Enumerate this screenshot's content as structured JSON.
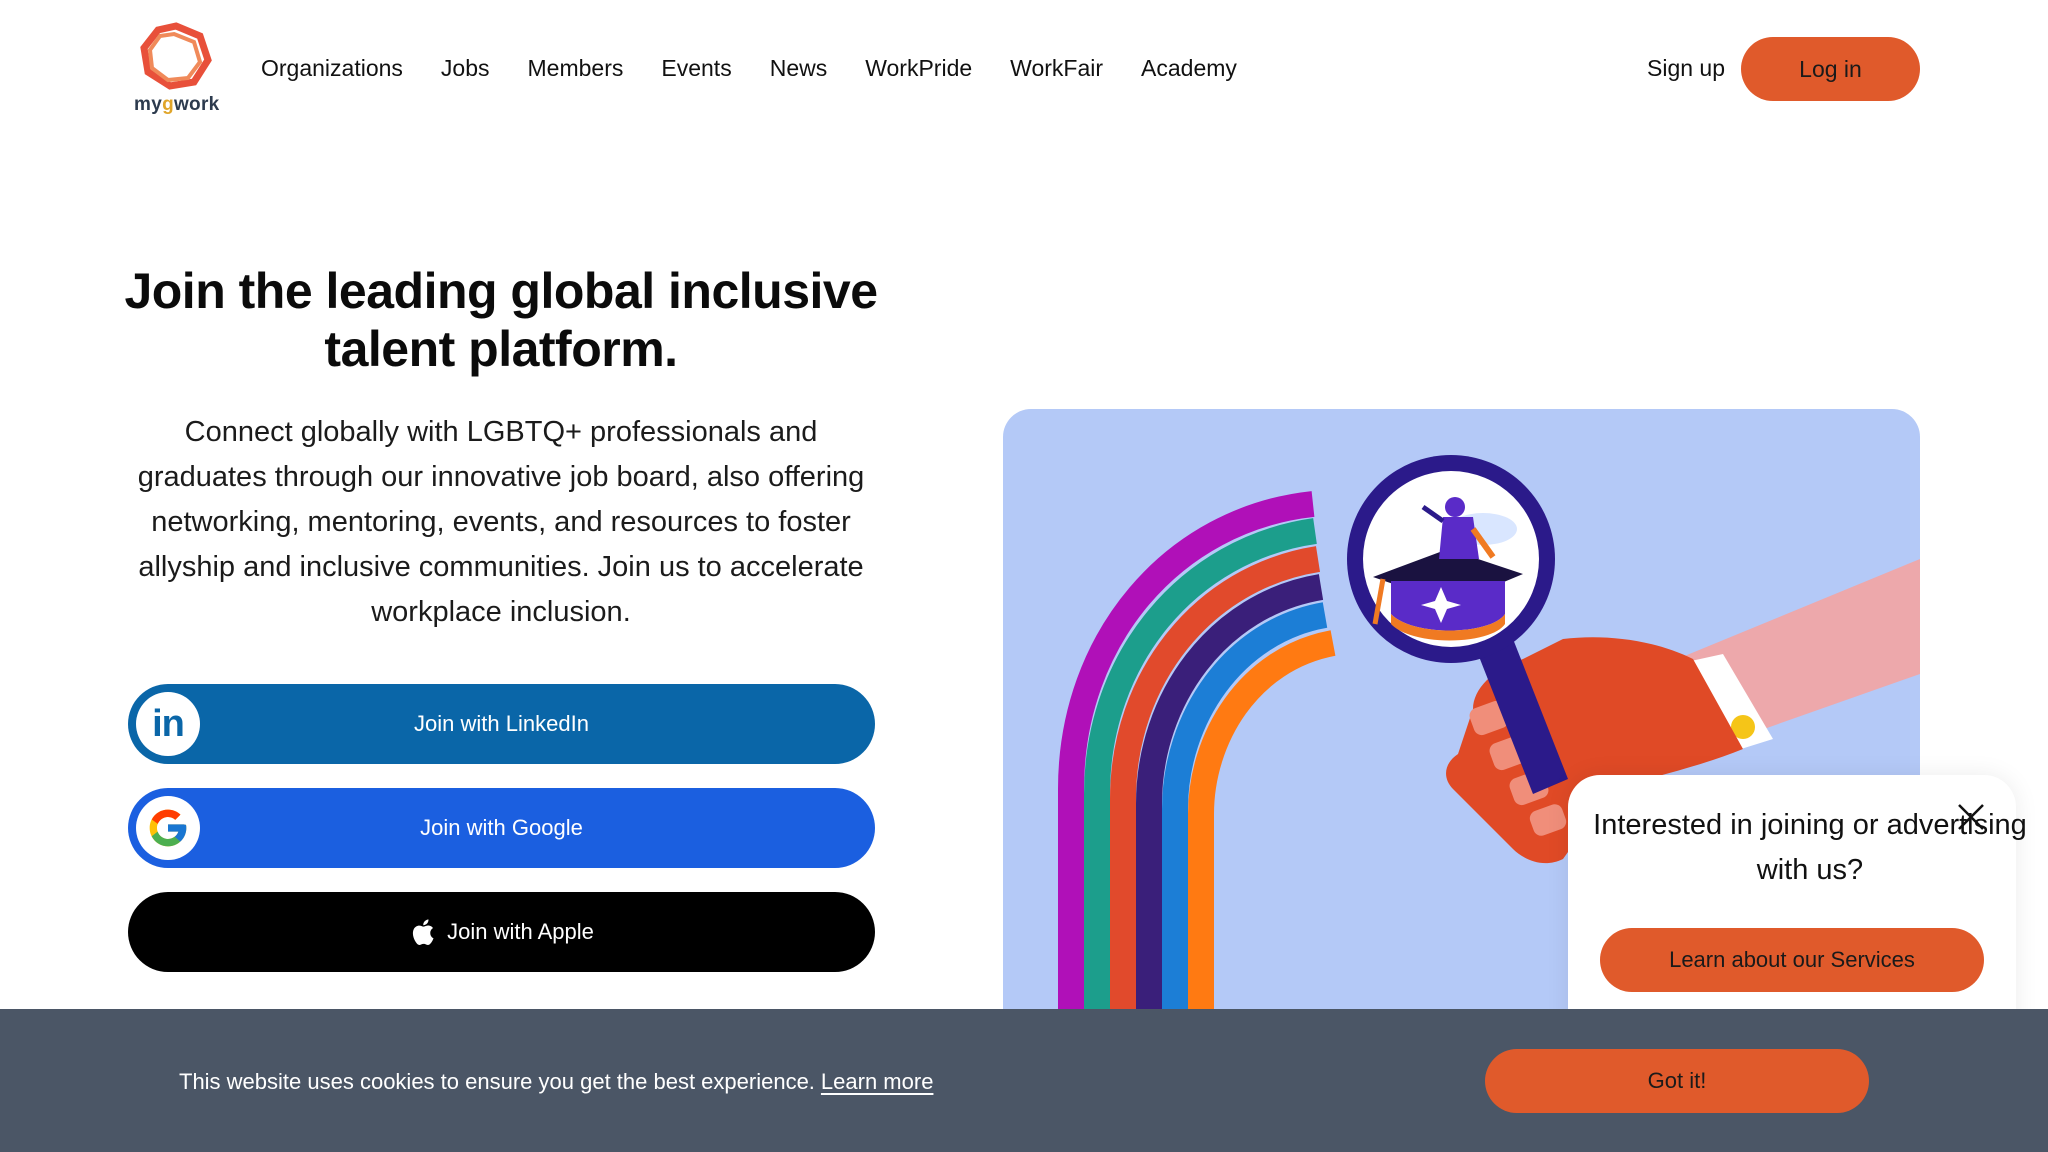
{
  "header": {
    "logo_text_a": "my",
    "logo_text_g": "g",
    "logo_text_b": "work",
    "nav": [
      {
        "label": "Organizations"
      },
      {
        "label": "Jobs"
      },
      {
        "label": "Members"
      },
      {
        "label": "Events"
      },
      {
        "label": "News"
      },
      {
        "label": "WorkPride"
      },
      {
        "label": "WorkFair"
      },
      {
        "label": "Academy"
      }
    ],
    "signup_label": "Sign up",
    "login_label": "Log in"
  },
  "hero": {
    "title": "Join the leading global inclusive talent platform.",
    "subtitle": "Connect globally with LGBTQ+ professionals and graduates through our innovative job board, also offering networking, mentoring, events, and resources to foster allyship and inclusive communities. Join us to accelerate workplace inclusion."
  },
  "join": {
    "linkedin_label": "Join with LinkedIn",
    "google_label": "Join with Google",
    "apple_label": "Join with Apple"
  },
  "popup": {
    "text": "Interested in joining or advertising with us?",
    "button_label": "Learn about our Services"
  },
  "cookie": {
    "text": "This website uses cookies to ensure you get the best experience.",
    "link_label": "Learn more",
    "button_label": "Got it!"
  },
  "colors": {
    "accent": "#e05a2b",
    "linkedin": "#0a66a8",
    "google": "#1b5fe0",
    "cookie_bg": "#4b5666",
    "illustration_bg": "#b4c9f7"
  }
}
